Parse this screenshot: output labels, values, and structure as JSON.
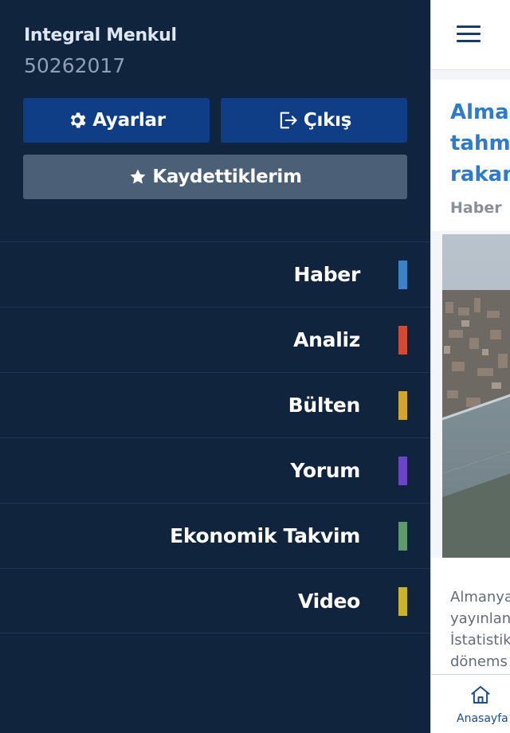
{
  "drawer": {
    "user_name": "Integral Menkul",
    "user_id": "50262017",
    "settings_label": "Ayarlar",
    "logout_label": "Çıkış",
    "saved_label": "Kaydettiklerim",
    "menu": [
      {
        "label": "Haber",
        "color": "#3c82c9"
      },
      {
        "label": "Analiz",
        "color": "#d04a35"
      },
      {
        "label": "Bülten",
        "color": "#d2a52e"
      },
      {
        "label": "Yorum",
        "color": "#6a45c8"
      },
      {
        "label": "Ekonomik Takvim",
        "color": "#5e9a6e"
      },
      {
        "label": "Video",
        "color": "#c8b42e"
      }
    ]
  },
  "content": {
    "article_title_lines": [
      "Almanya",
      "tahmin",
      "rakam"
    ],
    "article_category": "Haber",
    "article_text_lines": [
      "Almanya",
      "yayınlan",
      "İstatistik",
      "dönems"
    ],
    "bottom_nav_home_label": "Anasayfa"
  }
}
